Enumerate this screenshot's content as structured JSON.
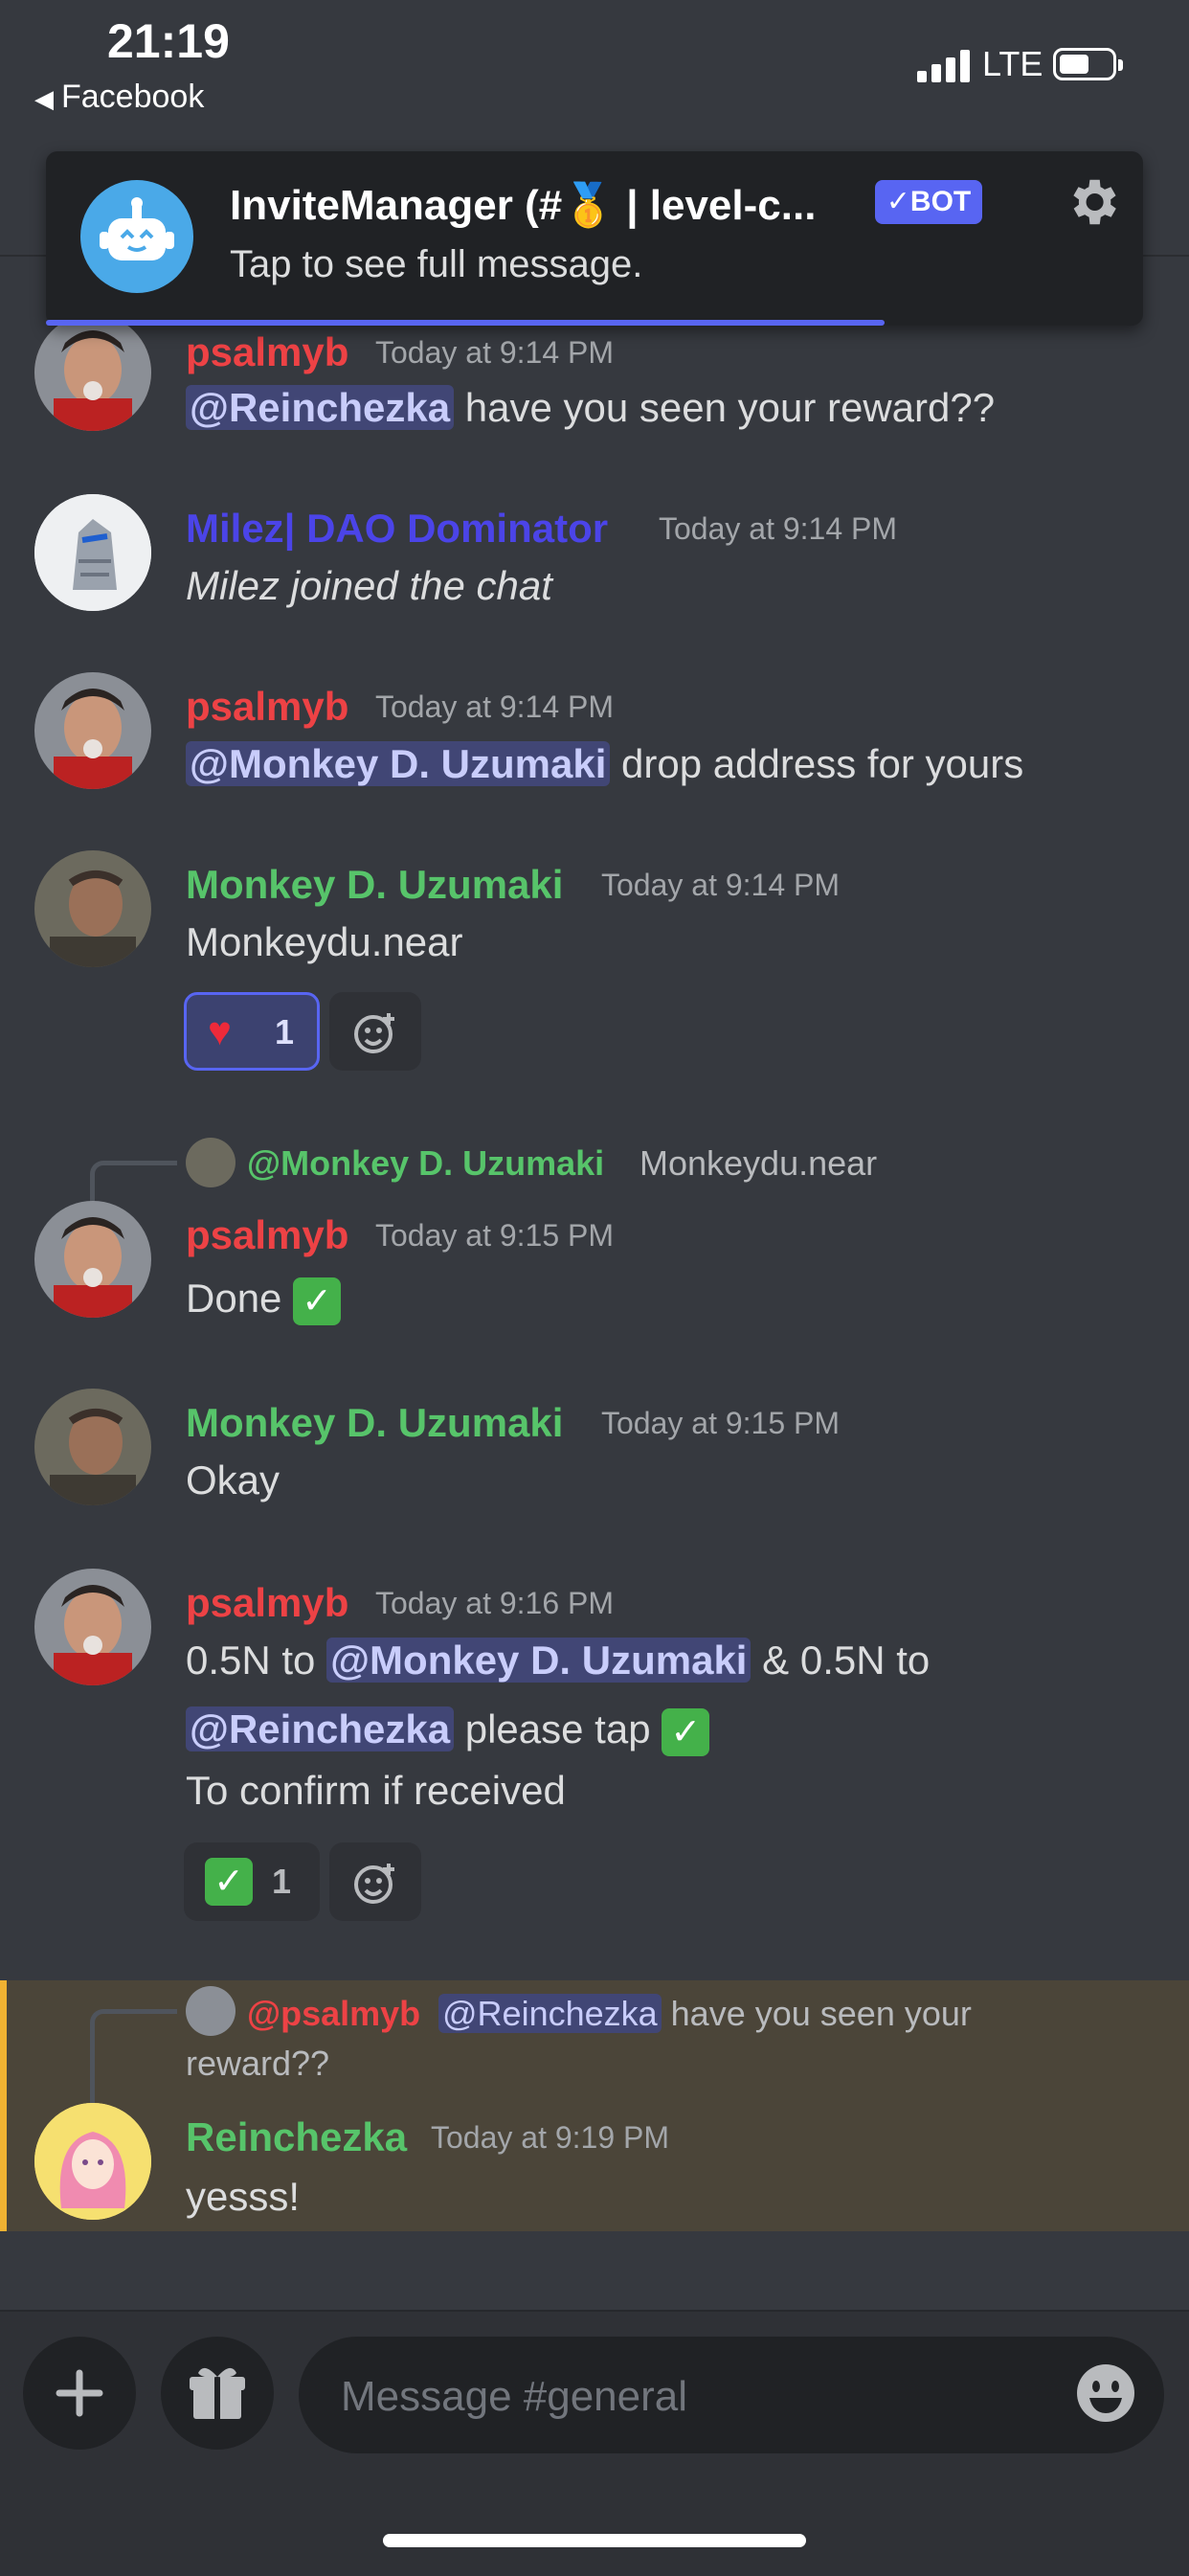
{
  "status_bar": {
    "time": "21:19",
    "back_app": "Facebook",
    "network": "LTE"
  },
  "notification": {
    "title": "InviteManager (#🥇 | level-c...",
    "bot_badge": "✓BOT",
    "body": "Tap to see full message."
  },
  "messages": [
    {
      "user": "psalmyb",
      "time": "Today at 9:14 PM",
      "mention": "@Reinchezka",
      "text": " have you seen your reward??"
    },
    {
      "user": "Milez| DAO Dominator",
      "time": "Today at 9:14 PM",
      "text": "Milez joined the chat"
    },
    {
      "user": "psalmyb",
      "time": "Today at 9:14 PM",
      "mention": "@Monkey D. Uzumaki",
      "text": " drop address for yours"
    },
    {
      "user": "Monkey D. Uzumaki",
      "time": "Today at 9:14 PM",
      "text": "Monkeydu.near",
      "reaction_emoji": "❤️",
      "reaction_count": "1"
    },
    {
      "reply_user": "@Monkey D. Uzumaki",
      "reply_text": "Monkeydu.near",
      "user": "psalmyb",
      "time": "Today at 9:15 PM",
      "text": "Done",
      "emoji": "✓"
    },
    {
      "user": "Monkey D. Uzumaki",
      "time": "Today at 9:15 PM",
      "text": "Okay"
    },
    {
      "user": "psalmyb",
      "time": "Today at 9:16 PM",
      "line1_a": "0.5N to ",
      "mention1": "@Monkey D. Uzumaki",
      "line1_b": " & 0.5N to",
      "mention2": "@Reinchezka",
      "line2_b": " please tap ",
      "emoji": "✓",
      "line3": "To confirm if received",
      "reaction_emoji": "✓",
      "reaction_count": "1"
    },
    {
      "reply_user": "@psalmyb",
      "reply_mention": "@Reinchezka",
      "reply_text_a": " have you seen your",
      "reply_text_b": "reward??",
      "user": "Reinchezka",
      "time": "Today at 9:19 PM",
      "text": "yesss!"
    }
  ],
  "composer": {
    "placeholder": "Message #general"
  },
  "colors": {
    "background": "#36393f",
    "red_user": "#ed4245",
    "green_user": "#57c46a",
    "blue_user": "#4b44e8",
    "blurple": "#5865f2",
    "highlight": "#4b4539",
    "highlight_bar": "#f0b232"
  }
}
